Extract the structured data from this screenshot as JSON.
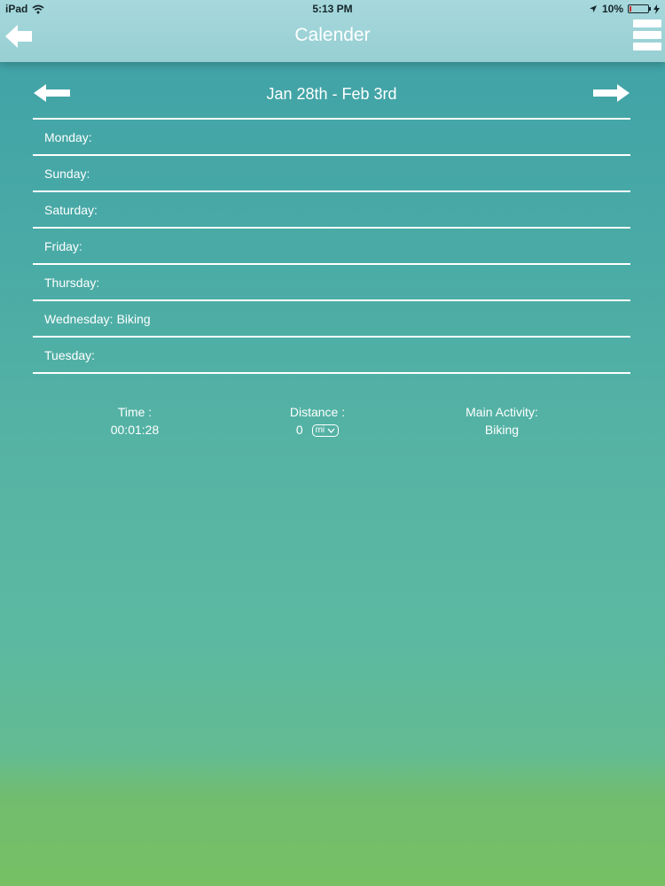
{
  "status_bar": {
    "device": "iPad",
    "time": "5:13 PM",
    "battery": "10%"
  },
  "nav": {
    "title": "Calender"
  },
  "week": {
    "label": "Jan 28th - Feb 3rd"
  },
  "days": [
    {
      "label": "Monday:",
      "activity": ""
    },
    {
      "label": "Sunday:",
      "activity": ""
    },
    {
      "label": "Saturday:",
      "activity": ""
    },
    {
      "label": "Friday:",
      "activity": ""
    },
    {
      "label": "Thursday:",
      "activity": ""
    },
    {
      "label": "Wednesday:",
      "activity": "Biking"
    },
    {
      "label": "Tuesday:",
      "activity": ""
    }
  ],
  "summary": {
    "time_label": "Time :",
    "time_value": "00:01:28",
    "distance_label": "Distance :",
    "distance_value": "0",
    "distance_unit": "mi",
    "activity_label": "Main Activity:",
    "activity_value": "Biking"
  },
  "colors": {
    "navbar": "#a6d8dc",
    "background_top": "#3fa1a7",
    "background_bottom": "#76c063",
    "text": "#ffffff",
    "battery_low": "#d32a2a"
  }
}
